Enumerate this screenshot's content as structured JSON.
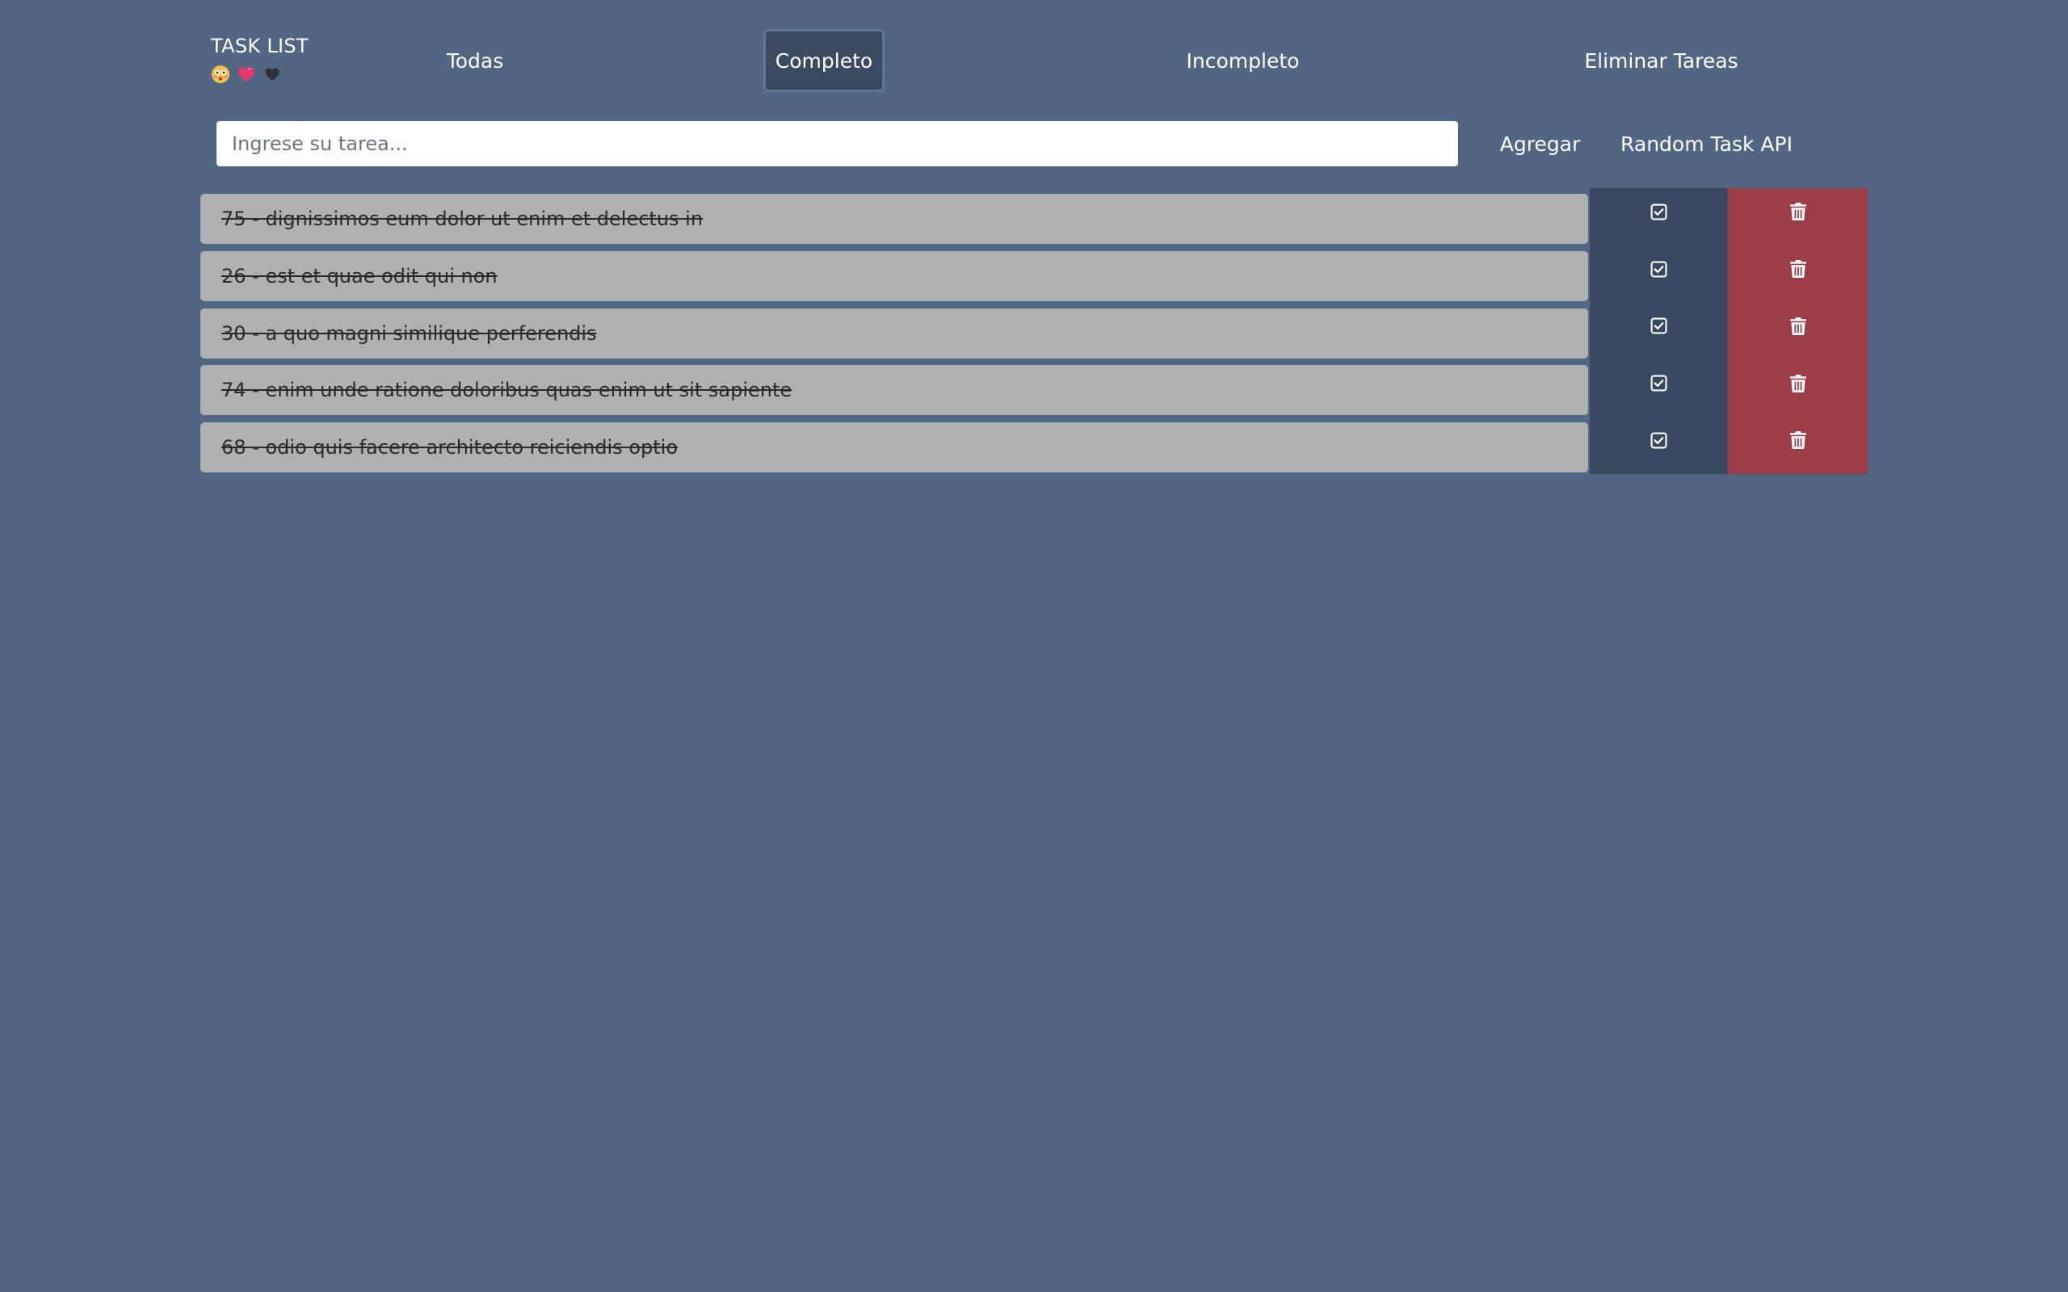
{
  "header": {
    "title": "TASK LIST",
    "emojis": [
      "flushed-face-emoji",
      "pink-heart-emoji",
      "black-heart-emoji"
    ]
  },
  "nav": {
    "all_label": "Todas",
    "completed_label": "Completo",
    "incomplete_label": "Incompleto",
    "delete_all_label": "Eliminar Tareas",
    "active": "Completo"
  },
  "form": {
    "placeholder": "Ingrese su tarea...",
    "value": "",
    "add_label": "Agregar",
    "random_label": "Random Task API"
  },
  "tasks": [
    {
      "text": "75 - dignissimos eum dolor ut enim et delectus in",
      "completed": true
    },
    {
      "text": "26 - est et quae odit qui non",
      "completed": true
    },
    {
      "text": "30 - a quo magni similique perferendis",
      "completed": true
    },
    {
      "text": "74 - enim unde ratione doloribus quas enim ut sit sapiente",
      "completed": true
    },
    {
      "text": "68 - odio quis facere architecto reiciendis optio",
      "completed": true
    }
  ],
  "icons": {
    "complete": "check-square-icon",
    "delete": "trash-icon"
  },
  "colors": {
    "background": "#516683",
    "active_tab": "#3b4a61",
    "task_box": "#b0b0b0",
    "complete_button": "#384860",
    "delete_button": "#9c3d48"
  }
}
